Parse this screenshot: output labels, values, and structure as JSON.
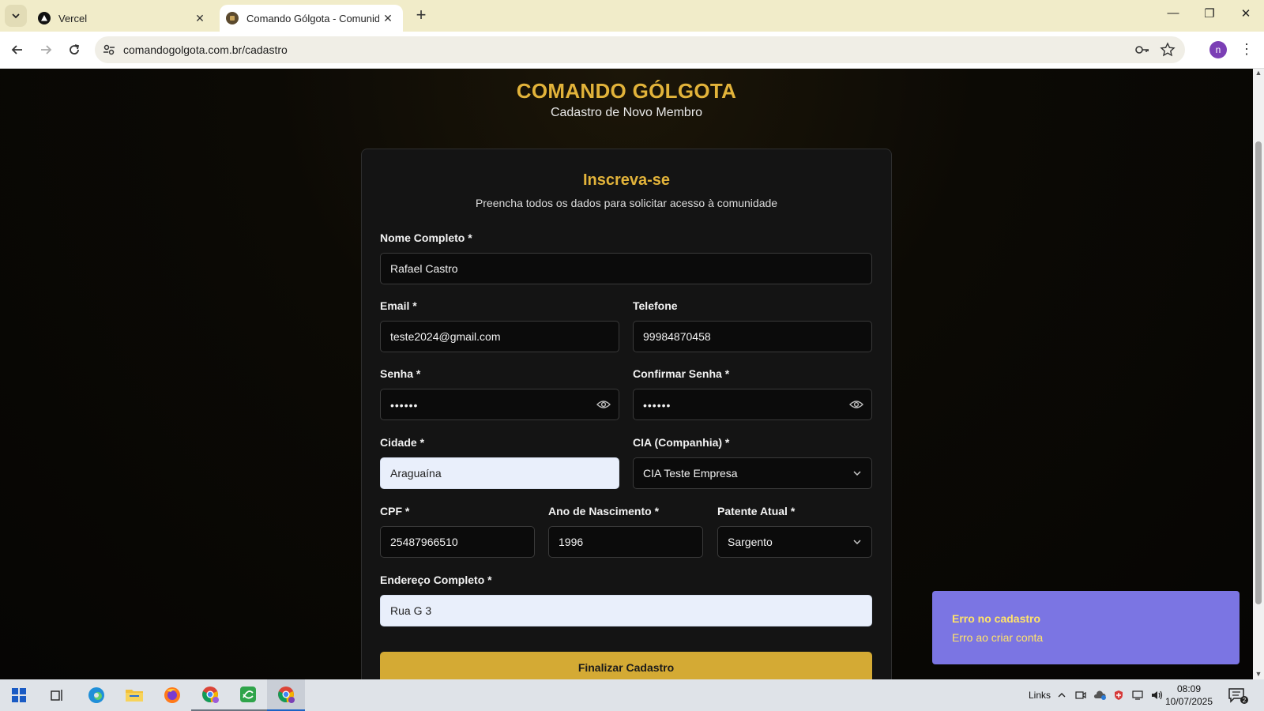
{
  "browser": {
    "tabs": [
      {
        "title": "Vercel",
        "active": false
      },
      {
        "title": "Comando Gólgota - Comunidade",
        "active": true
      }
    ],
    "url": "comandogolgota.com.br/cadastro",
    "profile_initial": "n"
  },
  "page": {
    "brand": "COMANDO GÓLGOTA",
    "brand_subtitle": "Cadastro de Novo Membro",
    "card": {
      "title": "Inscreva-se",
      "subtitle": "Preencha todos os dados para solicitar acesso à comunidade"
    },
    "form": {
      "nome": {
        "label": "Nome Completo *",
        "value": "Rafael Castro"
      },
      "email": {
        "label": "Email *",
        "value": "teste2024@gmail.com"
      },
      "telefone": {
        "label": "Telefone",
        "value": "99984870458"
      },
      "senha": {
        "label": "Senha *",
        "value": "••••••"
      },
      "confirmar_senha": {
        "label": "Confirmar Senha *",
        "value": "••••••"
      },
      "cidade": {
        "label": "Cidade *",
        "value": "Araguaína"
      },
      "cia": {
        "label": "CIA (Companhia) *",
        "value": "CIA Teste Empresa"
      },
      "cpf": {
        "label": "CPF *",
        "value": "25487966510"
      },
      "ano_nascimento": {
        "label": "Ano de Nascimento *",
        "value": "1996"
      },
      "patente": {
        "label": "Patente Atual *",
        "value": "Sargento"
      },
      "endereco": {
        "label": "Endereço Completo *",
        "value": "Rua G 3"
      },
      "submit_label": "Finalizar Cadastro"
    },
    "toast": {
      "title": "Erro no cadastro",
      "description": "Erro ao criar conta"
    }
  },
  "taskbar": {
    "links_label": "Links",
    "time": "08:09",
    "date": "10/07/2025",
    "notification_count": "2"
  },
  "colors": {
    "accent_gold": "#e2b33a",
    "button_gold": "#d4aa34",
    "toast_bg": "#7b75e3",
    "toast_text": "#ffe36a"
  }
}
